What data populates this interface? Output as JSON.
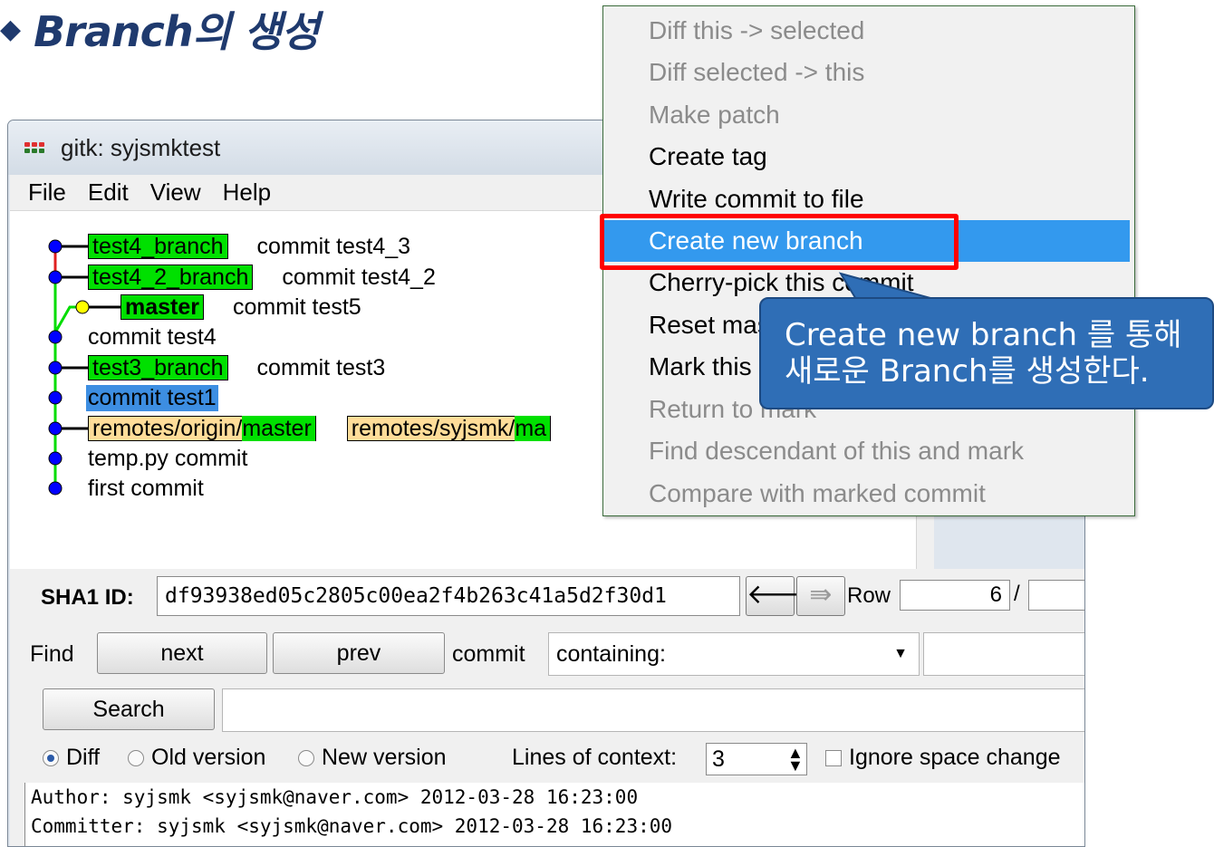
{
  "slide": {
    "bullet": "◆",
    "title": "Branch의 생성"
  },
  "window": {
    "title": "gitk: syjsmktest",
    "menu": [
      "File",
      "Edit",
      "View",
      "Help"
    ]
  },
  "graph": {
    "rows": [
      {
        "tags": [
          {
            "kind": "branch",
            "text": "test4_branch"
          }
        ],
        "message": "commit test4_3"
      },
      {
        "tags": [
          {
            "kind": "branch",
            "text": "test4_2_branch"
          }
        ],
        "message": "commit test4_2"
      },
      {
        "tags": [
          {
            "kind": "head",
            "text": "master"
          }
        ],
        "message": "commit test5"
      },
      {
        "tags": [],
        "message": "commit test4"
      },
      {
        "tags": [
          {
            "kind": "branch",
            "text": "test3_branch"
          }
        ],
        "message": "commit test3"
      },
      {
        "tags": [],
        "message": "commit test1",
        "selected": true
      },
      {
        "tags": [
          {
            "kind": "remote",
            "prefix": "remotes/origin/",
            "name": "master"
          },
          {
            "kind": "remote",
            "prefix": "remotes/syjsmk/",
            "name": "ma"
          }
        ],
        "message": ""
      },
      {
        "tags": [],
        "message": "temp.py commit"
      },
      {
        "tags": [],
        "message": "first commit"
      }
    ]
  },
  "sha": {
    "label": "SHA1 ID:",
    "value": "df93938ed05c2805c00ea2f4b263c41a5d2f30d1",
    "back_glyph": "🡐",
    "forward_glyph": "⇛",
    "row_label": "Row",
    "row_value": "6",
    "row_sep": "/"
  },
  "find": {
    "label": "Find",
    "next": "next",
    "prev": "prev",
    "type_label": "commit",
    "mode": "containing:",
    "search_button": "Search"
  },
  "options": {
    "diff": "Diff",
    "old_version": "Old version",
    "new_version": "New version",
    "context_label": "Lines of context:",
    "context_value": "3",
    "ignore_space": "Ignore space change"
  },
  "details": {
    "author": "Author: syjsmk <syjsmk@naver.com>  2012-03-28 16:23:00",
    "committer": "Committer: syjsmk <syjsmk@naver.com>  2012-03-28 16:23:00"
  },
  "context_menu": {
    "items": [
      {
        "label": "Diff this -> selected",
        "enabled": false
      },
      {
        "label": "Diff selected -> this",
        "enabled": false
      },
      {
        "label": "Make patch",
        "enabled": false
      },
      {
        "label": "Create tag",
        "enabled": true
      },
      {
        "label": "Write commit to file",
        "enabled": true
      },
      {
        "label": "Create new branch",
        "enabled": true,
        "highlighted": true
      },
      {
        "label": "Cherry-pick this commit",
        "enabled": true
      },
      {
        "label": "Reset master branch to here",
        "enabled": true
      },
      {
        "label": "Mark this commit",
        "enabled": true
      },
      {
        "label": "Return to mark",
        "enabled": false
      },
      {
        "label": "Find descendant of this and mark",
        "enabled": false
      },
      {
        "label": "Compare with marked commit",
        "enabled": false
      }
    ]
  },
  "callout": {
    "line1": "Create new branch 를 통해",
    "line2": "새로운 Branch를 생성한다."
  },
  "colors": {
    "branch_tag": "#00e000",
    "remote_tag": "#ffdd99",
    "commit_dot": "#0000ff",
    "head_dot": "#ffff00",
    "selection": "#3d8ee2",
    "menu_highlight": "#3399ee",
    "highlight_box": "#ff0000",
    "callout": "#2f6eb6",
    "title": "#1f3a6e"
  }
}
